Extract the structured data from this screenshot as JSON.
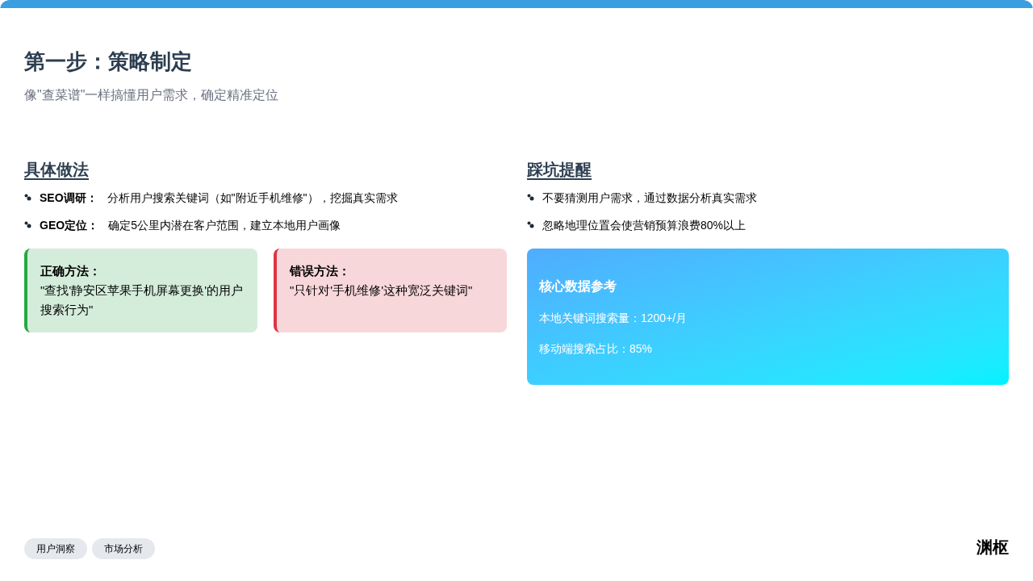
{
  "title": "第一步：策略制定",
  "subtitle": "像\"查菜谱\"一样搞懂用户需求，确定精准定位",
  "method": {
    "heading": "具体做法",
    "items": [
      {
        "label": "SEO调研：",
        "text": "分析用户搜索关键词（如\"附近手机维修\"），挖掘真实需求"
      },
      {
        "label": "GEO定位：",
        "text": "确定5公里内潜在客户范围，建立本地用户画像"
      }
    ],
    "examples": [
      {
        "kind": "correct",
        "label": "正确方法：",
        "text": "\"查找'静安区苹果手机屏幕更换'的用户搜索行为\""
      },
      {
        "kind": "wrong",
        "label": "错误方法：",
        "text": "\"只针对'手机维修'这种宽泛关键词\""
      }
    ]
  },
  "pitfalls": {
    "heading": "踩坑提醒",
    "items": [
      "不要猜测用户需求，通过数据分析真实需求",
      "忽略地理位置会使营销预算浪费80%以上"
    ],
    "data_card": {
      "title": "核心数据参考",
      "lines": [
        "本地关键词搜索量：1200+/月",
        "移动端搜索占比：85%"
      ]
    }
  },
  "tags": [
    "用户洞察",
    "市场分析"
  ],
  "brand": "渊枢"
}
